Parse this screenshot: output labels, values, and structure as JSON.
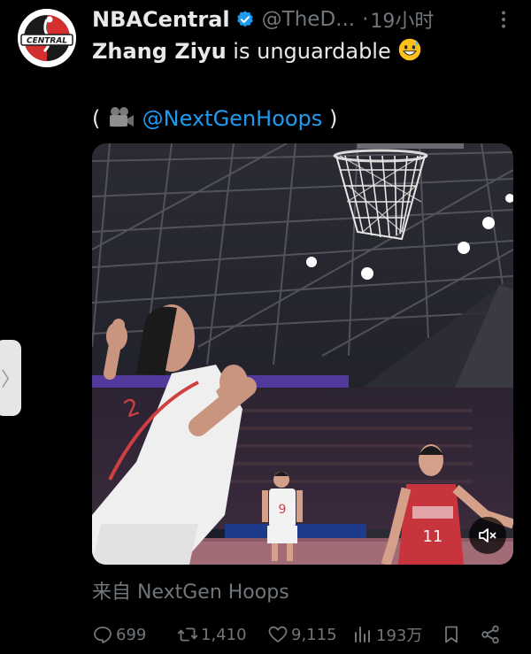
{
  "author": {
    "display_name": "NBACentral",
    "handle": "@TheD...",
    "separator": "·",
    "time": "19小时",
    "avatar_text": "CENTRAL",
    "verified": true
  },
  "tweet": {
    "text_bold": "Zhang Ziyu",
    "text_rest": " is unguardable",
    "emoji": "grinning-sweat-emoji",
    "credit_open": "(",
    "credit_icon": "video-camera-icon",
    "credit_mention": "@NextGenHoops",
    "credit_close": ")"
  },
  "media": {
    "type": "video",
    "muted": true,
    "mute_icon": "speaker-muted-icon"
  },
  "source": {
    "label": "来自 NextGen Hoops"
  },
  "actions": {
    "replies": "699",
    "retweets": "1,410",
    "likes": "9,115",
    "views": "193万",
    "bookmark_icon": "bookmark-icon",
    "share_icon": "share-icon"
  },
  "side_handle": {
    "glyph": "〉"
  },
  "colors": {
    "background": "#000000",
    "text_primary": "#e7e9ea",
    "text_secondary": "#71767b",
    "accent": "#1d9bf0"
  }
}
